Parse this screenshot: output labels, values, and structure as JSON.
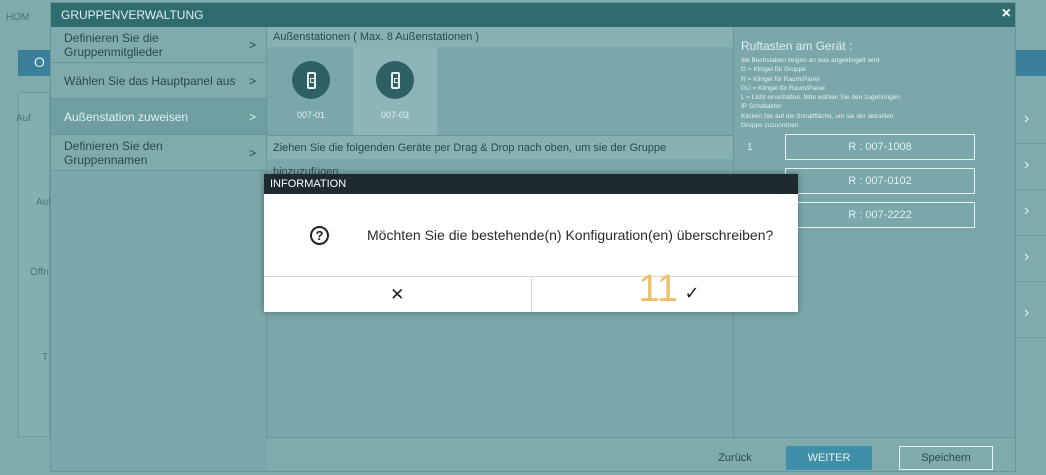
{
  "background": {
    "home_label": "HOM",
    "bar_label": "O",
    "side_labels": [
      "Auf",
      "Auf",
      "Öffn",
      "T"
    ]
  },
  "window": {
    "title": "GRUPPENVERWALTUNG",
    "close_icon": "×"
  },
  "nav": {
    "items": [
      {
        "label": "Definieren Sie die Gruppenmitglieder",
        "chevron": ">"
      },
      {
        "label": "Wählen Sie das Hauptpanel aus",
        "chevron": ">"
      },
      {
        "label": "Außenstation zuweisen",
        "chevron": ">"
      },
      {
        "label": "Definieren Sie den Gruppennamen",
        "chevron": ">"
      }
    ],
    "active_index": 2
  },
  "stations": {
    "title": "Außenstationen ( Max. 8 Außenstationen )",
    "items": [
      {
        "label": "007-01"
      },
      {
        "label": "007-03"
      }
    ],
    "drag_hint": "Ziehen Sie die folgenden Geräte per Drag & Drop nach oben, um sie der Gruppe hinzuzufügen"
  },
  "call_buttons": {
    "title": "Ruftasten am Gerät :",
    "description": [
      "die Buchstaben zeigen an was angeklingelt wird",
      "G = Klingel für Gruppe",
      "R = Klingel für Raum/Panel",
      "GU = Klingel für Raum/Panel",
      "L = Licht einschalten, bitte wählen Sie den zugehörigen",
      "IP Schaltaktor",
      "Klicken Sie auf die Schaltfläche, um sie der aktuellen",
      "Gruppe zuzuordnen"
    ],
    "rows": [
      {
        "number": "1",
        "label": "R : 007-1008"
      },
      {
        "number": "",
        "label": "R : 007-0102"
      },
      {
        "number": "",
        "label": "R : 007-2222"
      }
    ]
  },
  "footer": {
    "back": "Zurück",
    "next": "WEITER",
    "save": "Speichern"
  },
  "dialog": {
    "title": "INFORMATION",
    "icon": "?",
    "message": "Möchten Sie die bestehende(n) Konfiguration(en) überschreiben?",
    "cancel_symbol": "✕",
    "confirm_symbol": "✓",
    "overlay_number": "11"
  },
  "colors": {
    "header_teal": "#2f6c70",
    "modal_header": "#1e2a32",
    "accent_blue": "#3f8fa8",
    "overlay_number": "#f0bf6a"
  }
}
